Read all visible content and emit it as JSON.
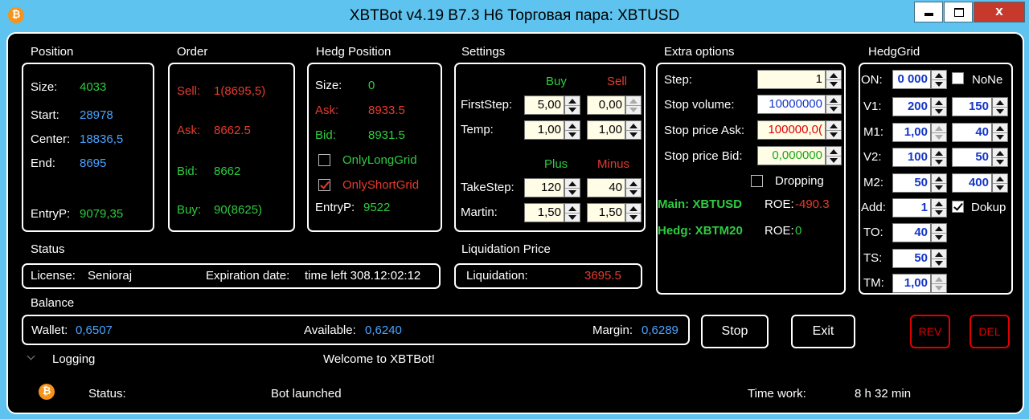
{
  "window": {
    "title": "XBTBot v4.19 B7.3 H6 Торговая пара: XBTUSD",
    "icon": "bitcoin-icon"
  },
  "position": {
    "header": "Position",
    "size_label": "Size:",
    "size": "4033",
    "start_label": "Start:",
    "start": "28978",
    "center_label": "Center:",
    "center": "18836,5",
    "end_label": "End:",
    "end": "8695",
    "entry_label": "EntryP:",
    "entry": "9079,35"
  },
  "order": {
    "header": "Order",
    "sell_label": "Sell:",
    "sell": "1(8695,5)",
    "ask_label": "Ask:",
    "ask": "8662.5",
    "bid_label": "Bid:",
    "bid": "8662",
    "buy_label": "Buy:",
    "buy": "90(8625)"
  },
  "hedg": {
    "header": "Hedg Position",
    "size_label": "Size:",
    "size": "0",
    "ask_label": "Ask:",
    "ask": "8933.5",
    "bid_label": "Bid:",
    "bid": "8931.5",
    "only_long": "OnlyLongGrid",
    "only_short": "OnlyShortGrid",
    "entry_label": "EntryP:",
    "entry": "9522"
  },
  "settings": {
    "header": "Settings",
    "buy": "Buy",
    "sell": "Sell",
    "firststep_label": "FirstStep:",
    "firststep_buy": "5,00",
    "firststep_sell": "0,00",
    "temp_label": "Temp:",
    "temp_buy": "1,00",
    "temp_sell": "1,00",
    "plus": "Plus",
    "minus": "Minus",
    "takestep_label": "TakeStep:",
    "takestep_plus": "120",
    "takestep_minus": "40",
    "martin_label": "Martin:",
    "martin_plus": "1,50",
    "martin_minus": "1,50"
  },
  "extra": {
    "header": "Extra options",
    "step_label": "Step:",
    "step": "1",
    "stop_volume_label": "Stop volume:",
    "stop_volume": "10000000",
    "stop_ask_label": "Stop price Ask:",
    "stop_ask": "100000,0(",
    "stop_bid_label": "Stop price Bid:",
    "stop_bid": "0,000000",
    "dropping": "Dropping",
    "main_label": "Main: XBTUSD",
    "main_roe_label": "ROE:",
    "main_roe": "-490.3",
    "hedg_label": "Hedg: XBTM20",
    "hedg_roe_label": "ROE:",
    "hedg_roe": "0"
  },
  "hedggrid": {
    "header": "HedgGrid",
    "on_label": "ON:",
    "on": "0 000",
    "none": "NoNe",
    "v1_label": "V1:",
    "v1_a": "200",
    "v1_b": "150",
    "m1_label": "M1:",
    "m1_a": "1,00",
    "m1_b": "40",
    "v2_label": "V2:",
    "v2_a": "100",
    "v2_b": "50",
    "m2_label": "M2:",
    "m2_a": "50",
    "m2_b": "400",
    "add_label": "Add:",
    "add": "1",
    "dokup": "Dokup",
    "to_label": "TO:",
    "to": "40",
    "ts_label": "TS:",
    "ts": "50",
    "tm_label": "TM:",
    "tm": "1,00"
  },
  "status": {
    "header": "Status",
    "license_label": "License:",
    "license": "Senioraj",
    "expiration_label": "Expiration date:",
    "expiration": "time left 308.12:02:12"
  },
  "liquidation": {
    "header": "Liquidation Price",
    "label": "Liquidation:",
    "value": "3695.5"
  },
  "balance": {
    "header": "Balance",
    "wallet_label": "Wallet:",
    "wallet": "0,6507",
    "available_label": "Available:",
    "available": "0,6240",
    "margin_label": "Margin:",
    "margin": "0,6289"
  },
  "buttons": {
    "stop": "Stop",
    "exit": "Exit",
    "rev": "REV",
    "del": "DEL"
  },
  "logging": {
    "label": "Logging",
    "welcome": "Welcome to XBTBot!"
  },
  "footer": {
    "status_label": "Status:",
    "status": "Bot launched",
    "time_label": "Time work:",
    "time": "8 h 32 min"
  },
  "colors": {
    "background": "#000000",
    "titlebar": "#5ec3ee",
    "green": "#2ecc40",
    "blue": "#4aa3ff",
    "red": "#e63b2e",
    "close": "#c7392b"
  }
}
